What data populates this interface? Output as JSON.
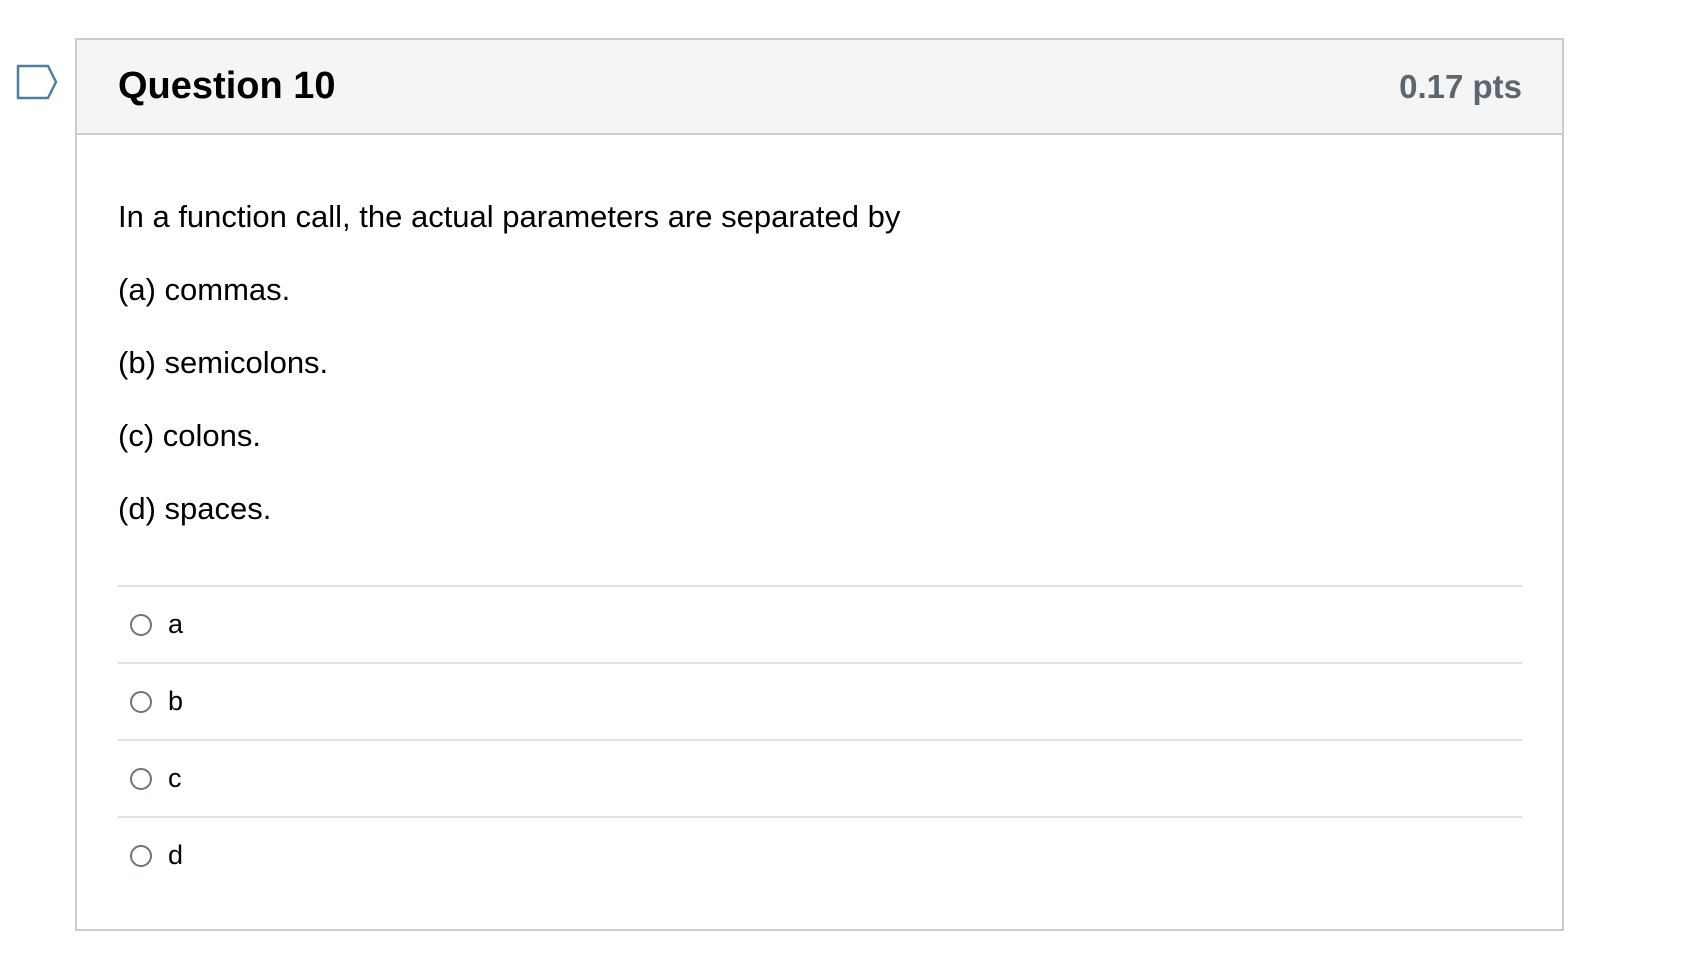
{
  "question": {
    "title": "Question 10",
    "points": "0.17 pts",
    "flag_icon": "bookmark-flag-icon",
    "text": "In a function call, the actual parameters are separated by",
    "choices": [
      "(a) commas.",
      "(b) semicolons.",
      "(c) colons.",
      "(d) spaces."
    ]
  },
  "answers": [
    {
      "label": "a"
    },
    {
      "label": "b"
    },
    {
      "label": "c"
    },
    {
      "label": "d"
    }
  ],
  "colors": {
    "header_bg": "#f5f5f5",
    "border": "#c7cdd1",
    "points_text": "#5b6770",
    "flag_outline": "#4a7fa8"
  }
}
